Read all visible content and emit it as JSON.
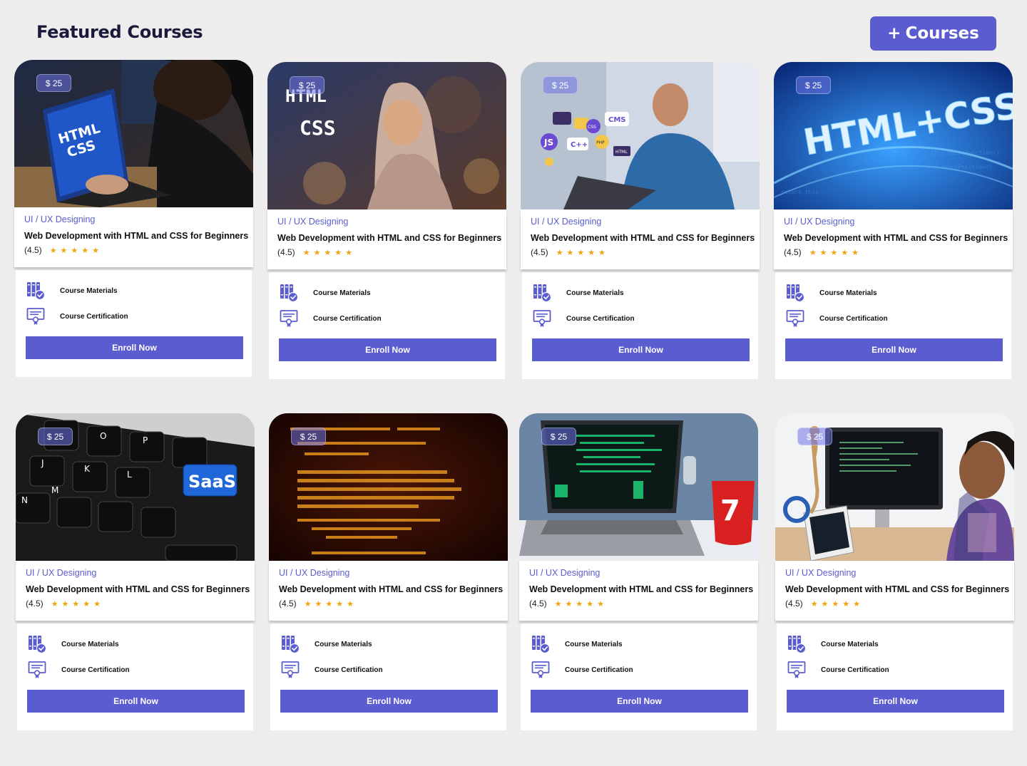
{
  "header": {
    "title": "Featured Courses",
    "add_button": "Courses",
    "add_icon": "+"
  },
  "colors": {
    "accent": "#5a5ccf",
    "star": "#f2a30f"
  },
  "courses": [
    {
      "price": "$ 25",
      "category": "UI / UX Designing",
      "title": "Web Development with HTML and CSS for Beginners",
      "rating": "(4.5)",
      "stars": "★★★★★",
      "feature1": "Course Materials",
      "feature2": "Course Certification",
      "enroll": "Enroll Now"
    },
    {
      "price": "$ 25",
      "category": "UI / UX Designing",
      "title": "Web Development with HTML and CSS for Beginners",
      "rating": "(4.5)",
      "stars": "★★★★★",
      "feature1": "Course Materials",
      "feature2": "Course Certification",
      "enroll": "Enroll Now"
    },
    {
      "price": "$ 25",
      "category": "UI / UX Designing",
      "title": "Web Development with HTML and CSS for Beginners",
      "rating": "(4.5)",
      "stars": "★★★★★",
      "feature1": "Course Materials",
      "feature2": "Course Certification",
      "enroll": "Enroll Now"
    },
    {
      "price": "$ 25",
      "category": "UI / UX Designing",
      "title": "Web Development with HTML and CSS for Beginners",
      "rating": "(4.5)",
      "stars": "★★★★★",
      "feature1": "Course Materials",
      "feature2": "Course Certification",
      "enroll": "Enroll Now"
    },
    {
      "price": "$ 25",
      "category": "UI / UX Designing",
      "title": "Web Development with HTML and CSS for Beginners",
      "rating": "(4.5)",
      "stars": "★★★★★",
      "feature1": "Course Materials",
      "feature2": "Course Certification",
      "enroll": "Enroll Now"
    },
    {
      "price": "$ 25",
      "category": "UI / UX Designing",
      "title": "Web Development with HTML and CSS for Beginners",
      "rating": "(4.5)",
      "stars": "★★★★★",
      "feature1": "Course Materials",
      "feature2": "Course Certification",
      "enroll": "Enroll Now"
    },
    {
      "price": "$ 25",
      "category": "UI / UX Designing",
      "title": "Web Development with HTML and CSS for Beginners",
      "rating": "(4.5)",
      "stars": "★★★★★",
      "feature1": "Course Materials",
      "feature2": "Course Certification",
      "enroll": "Enroll Now"
    },
    {
      "price": "$ 25",
      "category": "UI / UX Designing",
      "title": "Web Development with HTML and CSS for Beginners",
      "rating": "(4.5)",
      "stars": "★★★★★",
      "feature1": "Course Materials",
      "feature2": "Course Certification",
      "enroll": "Enroll Now"
    }
  ],
  "thumbnails": {
    "c0": {
      "line1": "HTML",
      "line2": "CSS"
    },
    "c1": {
      "line1": "HTML",
      "line2": "CSS"
    },
    "c2": {
      "tag1": "CMS",
      "tag2": "CSS",
      "tag3": "C++",
      "tag4": "PHP",
      "tag5": "HTML",
      "tag6": "JS"
    },
    "c3": {
      "text": "HTML+CSS"
    },
    "c4": {
      "saas": "SaaS",
      "k1": "O",
      "k2": "P",
      "k3": "J",
      "k4": "K",
      "k5": "L",
      "k6": "N",
      "k7": "M"
    },
    "c5": {},
    "c6": {
      "mug": "7"
    },
    "c7": {}
  }
}
